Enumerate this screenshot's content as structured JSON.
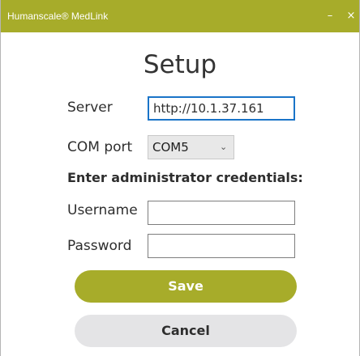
{
  "window": {
    "title": "Humanscale® MedLink",
    "minimize_glyph": "–",
    "close_glyph": "×"
  },
  "form": {
    "heading": "Setup",
    "server": {
      "label": "Server",
      "value": "http://10.1.37.161"
    },
    "com_port": {
      "label": "COM port",
      "selected": "COM5",
      "arrow_glyph": "⌄"
    },
    "credentials_heading": "Enter administrator credentials:",
    "username": {
      "label": "Username",
      "value": ""
    },
    "password": {
      "label": "Password",
      "value": ""
    }
  },
  "actions": {
    "save_label": "Save",
    "cancel_label": "Cancel"
  },
  "colors": {
    "accent": "#a7ac2a",
    "focus_border": "#1a74c8",
    "cancel_bg": "#e4e4e6"
  },
  "icons": {
    "minimize": "minimize-icon",
    "close": "close-icon",
    "dropdown": "chevron-down-icon"
  }
}
